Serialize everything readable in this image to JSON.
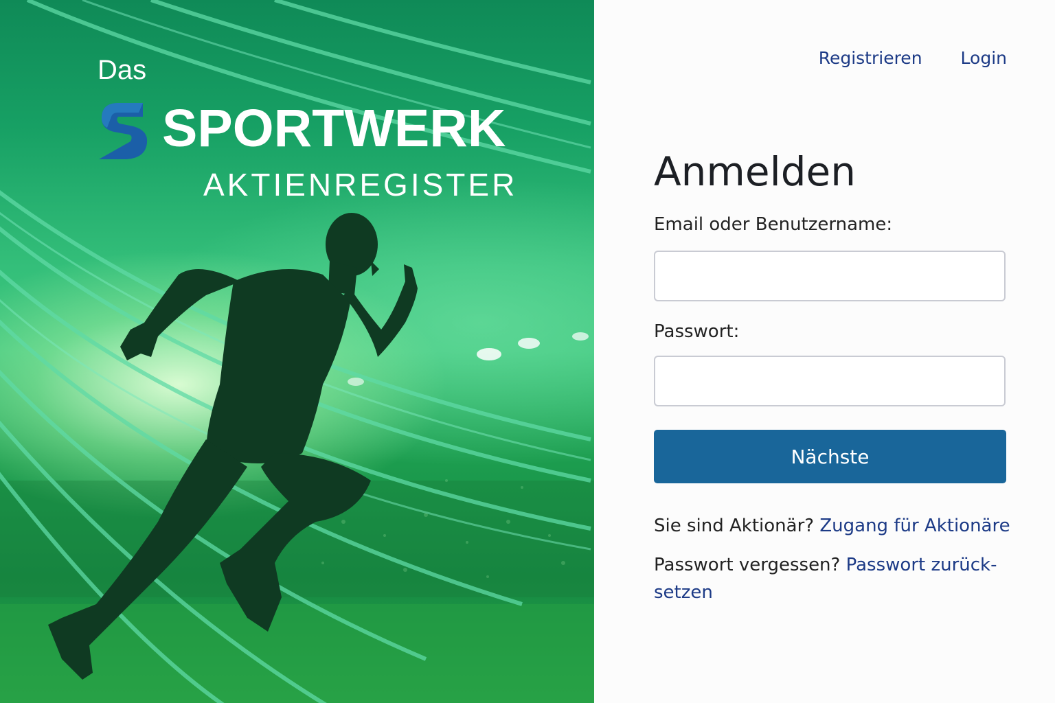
{
  "brand": {
    "prefix": "Das",
    "name": "SPORTWERK",
    "subtitle": "AKTIENREGISTER"
  },
  "nav": {
    "register": "Registrieren",
    "login": "Login"
  },
  "form": {
    "title": "Anmelden",
    "email_label": "Email oder Benutzername:",
    "email_value": "",
    "password_label": "Passwort:",
    "password_value": "",
    "submit": "Nächste"
  },
  "links": {
    "shareholder_text": "Sie sind Aktionär?",
    "shareholder_link": "Zugang für Aktionäre",
    "forgot_text": "Passwort vergessen?",
    "forgot_link": "Passwort zurück-setzen"
  },
  "colors": {
    "hero_green": "#17a064",
    "link_blue": "#1c3a86",
    "button_blue": "#19669a",
    "logo_blue": "#1b5fa8"
  },
  "hero_image": "runner-silhouette-stadium"
}
